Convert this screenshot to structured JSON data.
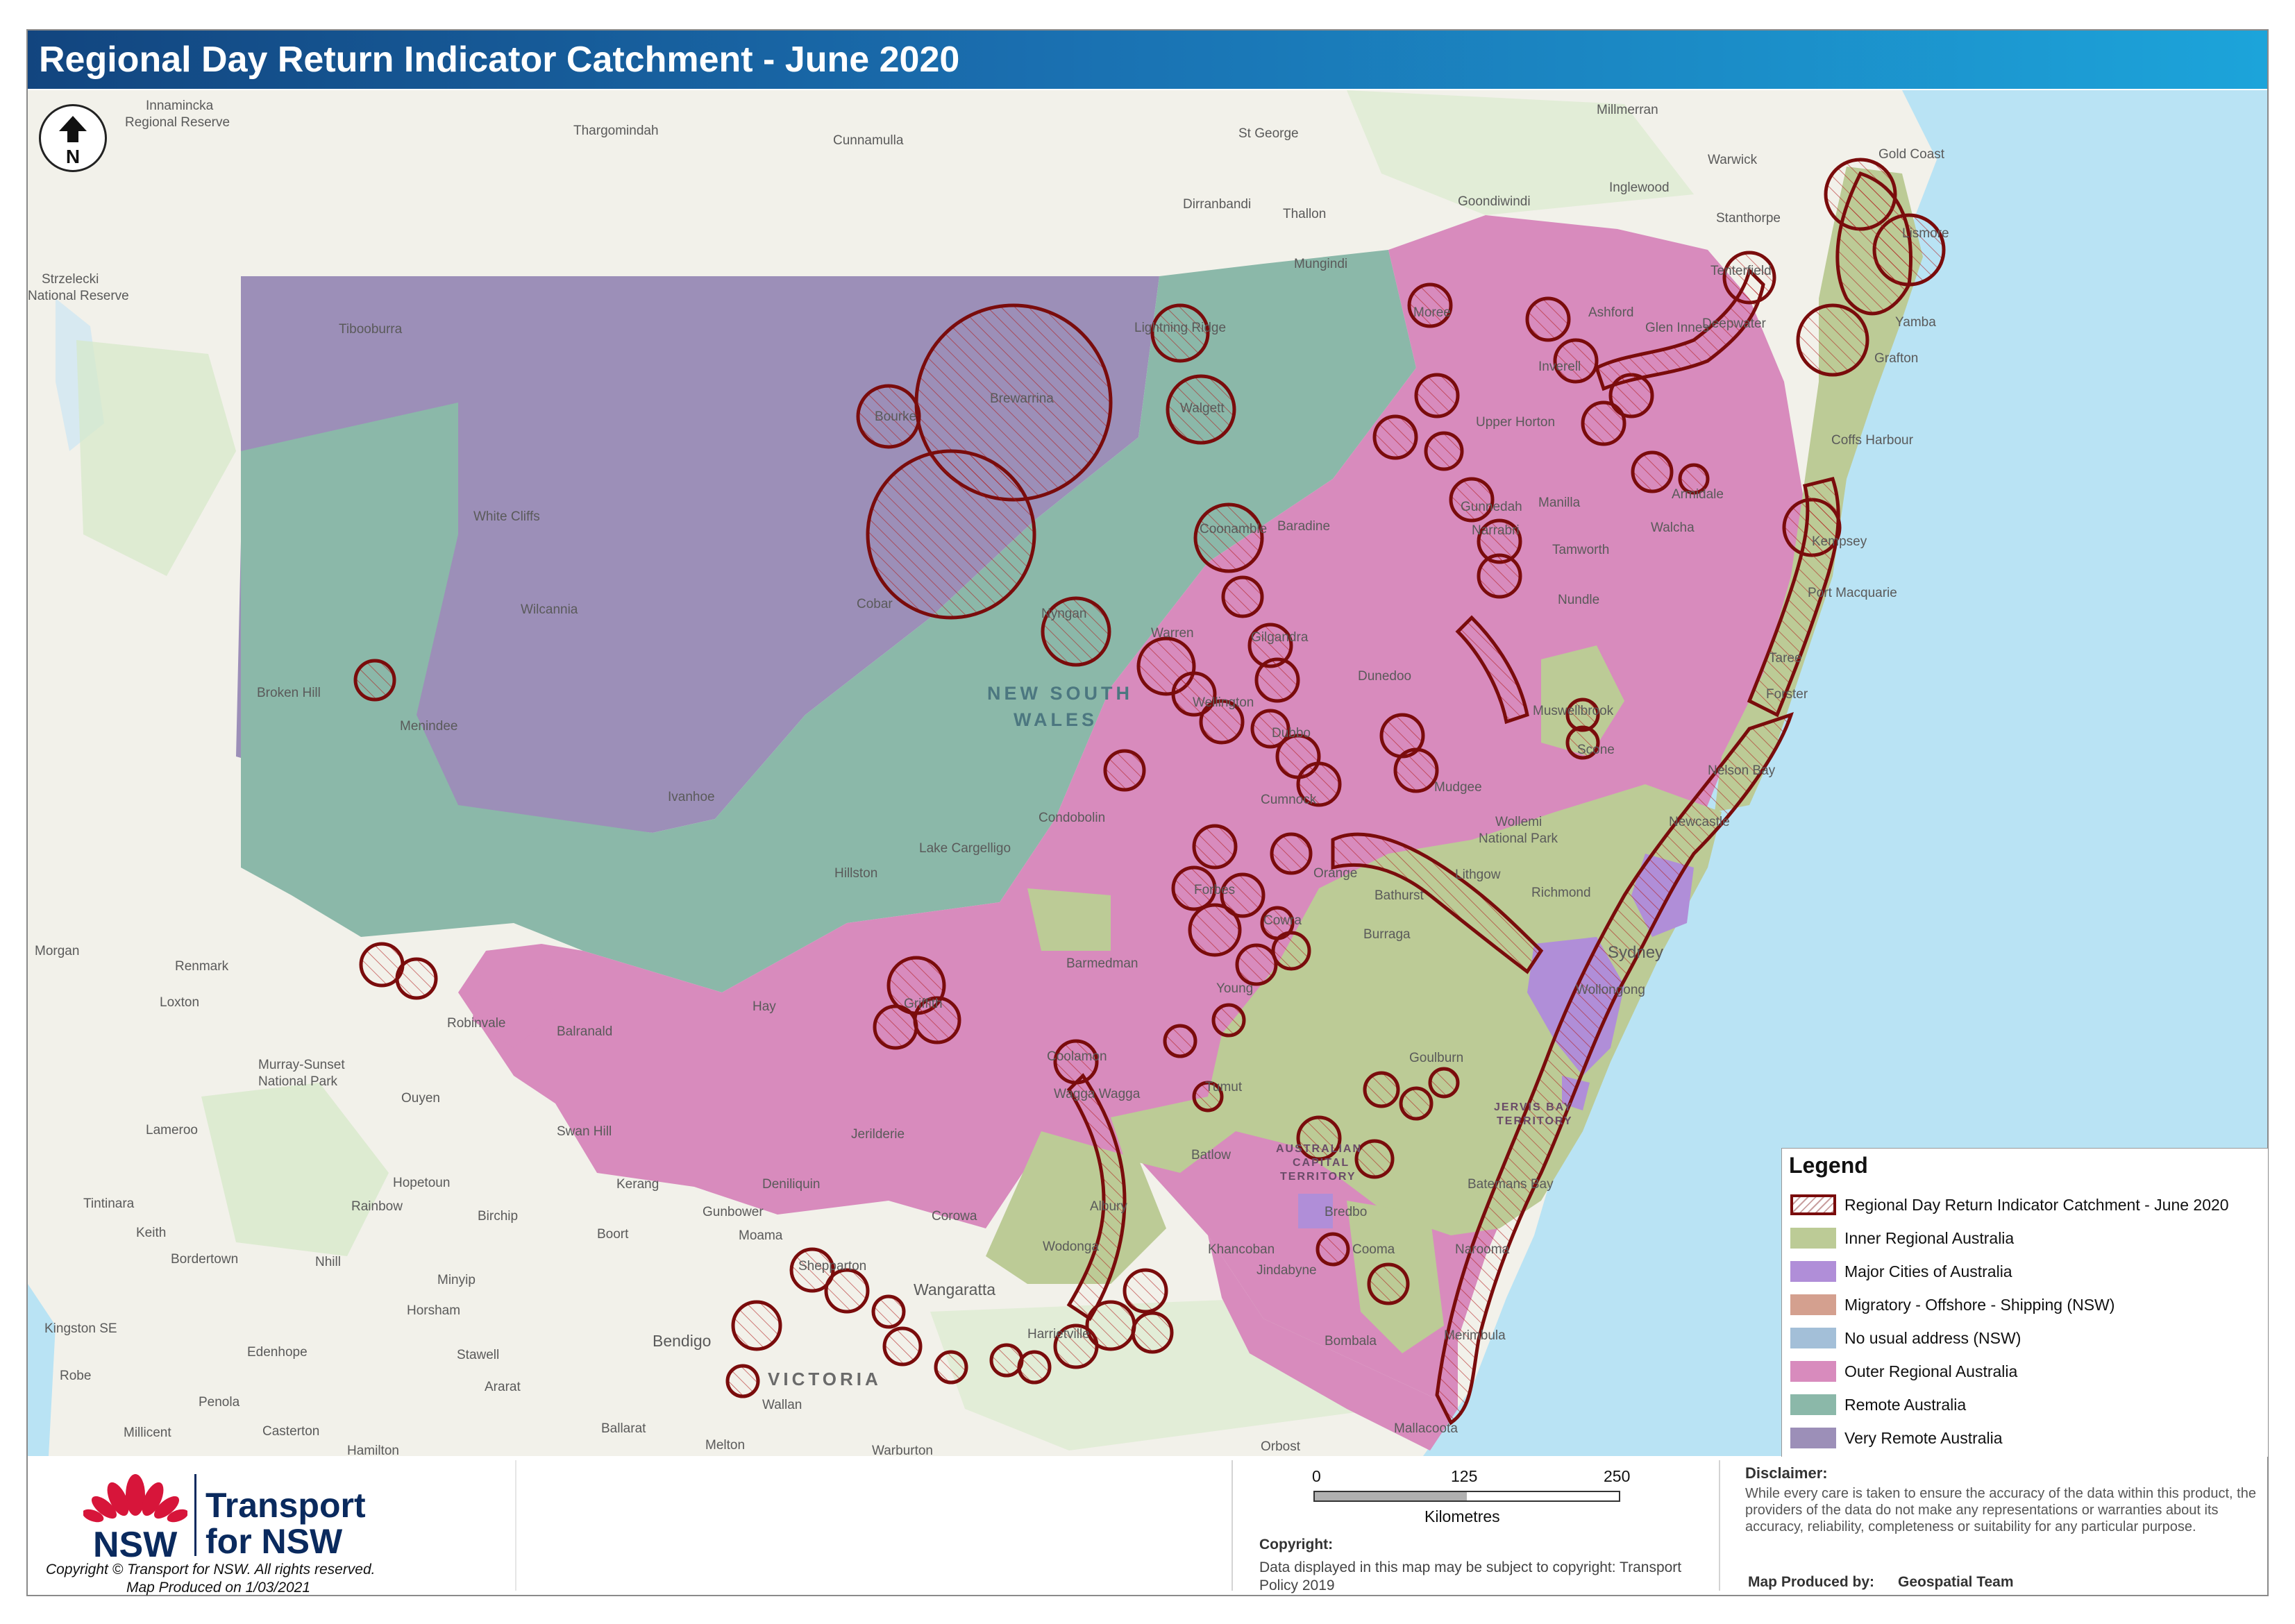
{
  "title": "Regional Day Return Indicator Catchment - June 2020",
  "north_label": "N",
  "colors": {
    "inner_regional": "#bccb96",
    "major_cities": "#b08ed8",
    "migratory": "#d4a08f",
    "no_usual_address": "#a3bfd8",
    "outer_regional": "#d88bbd",
    "remote": "#8bb8a9",
    "very_remote": "#9c8fb8",
    "catchment_outline": "#7a0c0c",
    "ocean": "#b9e3f4",
    "land": "#f2f1ea"
  },
  "legend": {
    "title": "Legend",
    "items": [
      {
        "label": "Regional Day Return Indicator Catchment - June 2020",
        "swatch": "catchment"
      },
      {
        "label": "Inner Regional Australia",
        "swatch": "#bccb96"
      },
      {
        "label": "Major Cities of Australia",
        "swatch": "#b08ed8"
      },
      {
        "label": "Migratory - Offshore - Shipping (NSW)",
        "swatch": "#d4a08f"
      },
      {
        "label": "No usual address (NSW)",
        "swatch": "#a3bfd8"
      },
      {
        "label": "Outer Regional Australia",
        "swatch": "#d88bbd"
      },
      {
        "label": "Remote Australia",
        "swatch": "#8bb8a9"
      },
      {
        "label": "Very Remote Australia",
        "swatch": "#9c8fb8"
      }
    ]
  },
  "places": {
    "innamincka": "Innamincka",
    "innamincka2": "Regional Reserve",
    "thargomindah": "Thargomindah",
    "cunnamulla": "Cunnamulla",
    "stgeorge": "St George",
    "millmerran": "Millmerran",
    "warwick": "Warwick",
    "goldcoast": "Gold Coast",
    "inglewood": "Inglewood",
    "dirranbandi": "Dirranbandi",
    "thallon": "Thallon",
    "goondiwindi": "Goondiwindi",
    "stanthorpe": "Stanthorpe",
    "mungindi": "Mungindi",
    "strzelecki": "Strzelecki",
    "strzelecki2": "National Reserve",
    "tibooburra": "Tibooburra",
    "lightningridge": "Lightning Ridge",
    "ashford": "Ashford",
    "brewarrina": "Brewarrina",
    "walgett": "Walgett",
    "bourke": "Bourke",
    "upperhorton": "Upper Horton",
    "coffsharbour": "Coffs Harbour",
    "whitecliffs": "White Cliffs",
    "armidale": "Armidale",
    "baradine": "Baradine",
    "coonamble": "Coonamble",
    "walcha": "Walcha",
    "kempsey": "Kempsey",
    "wilcannia": "Wilcannia",
    "cobar": "Cobar",
    "nundle": "Nundle",
    "portmacquarie": "Port Macquarie",
    "brokenhill": "Broken Hill",
    "newsouthwales1": "NEW SOUTH",
    "newsouthwales2": "WALES",
    "dunedoo": "Dunedoo",
    "menindee": "Menindee",
    "muswellbrook": "Muswellbrook",
    "ivanhoe": "Ivanhoe",
    "cumnock": "Cumnock",
    "condobolin": "Condobolin",
    "wollemi": "Wollemi",
    "wollemi2": "National Park",
    "newcastle": "Newcastle",
    "lakecargelligo": "Lake Cargelligo",
    "hillston": "Hillston",
    "sydney": "Sydney",
    "morgan": "Morgan",
    "renmark": "Renmark",
    "loxton": "Loxton",
    "barmedman": "Barmedman",
    "burraga": "Burraga",
    "hay": "Hay",
    "robinvale": "Robinvale",
    "balranald": "Balranald",
    "young": "Young",
    "murraysunset": "Murray-Sunset",
    "murraysunset2": "National Park",
    "ouyen": "Ouyen",
    "lameroo": "Lameroo",
    "swanhill": "Swan Hill",
    "jerilderie": "Jerilderie",
    "tumut": "Tumut",
    "actlabel1": "AUSTRALIAN",
    "actlabel2": "CAPITAL",
    "actlabel3": "TERRITORY",
    "batlow": "Batlow",
    "kerang": "Kerang",
    "hopetoun": "Hopetoun",
    "rainbow": "Rainbow",
    "birchip": "Birchip",
    "tintinara": "Tintinara",
    "keith": "Keith",
    "boort": "Boort",
    "bordertown": "Bordertown",
    "nhill": "Nhill",
    "minyip": "Minyip",
    "shepparton": "Shepparton",
    "khancoban": "Khancoban",
    "jindabyne": "Jindabyne",
    "cooma": "Cooma",
    "wangaratta": "Wangaratta",
    "horsham": "Horsham",
    "kingstonse": "Kingston SE",
    "bendigo": "Bendigo",
    "harrietville": "Harrietville",
    "bombala": "Bombala",
    "edenhope": "Edenhope",
    "stawell": "Stawell",
    "robe": "Robe",
    "victoria": "VICTORIA",
    "ararat": "Ararat",
    "penola": "Penola",
    "wallan": "Wallan",
    "millicent": "Millicent",
    "casterton": "Casterton",
    "ballarat": "Ballarat",
    "mallacoota": "Mallacoota",
    "hamilton": "Hamilton",
    "melton": "Melton",
    "warburton": "Warburton",
    "orbost": "Orbost",
    "gunbower": "Gunbower",
    "deniliquin": "Deniliquin",
    "griffith": "Griffith",
    "coolamon": "Coolamon",
    "waggawagga": "Wagga Wagga",
    "forbes": "Forbes",
    "orange": "Orange",
    "lithgow": "Lithgow",
    "richmond": "Richmond",
    "bathurst": "Bathurst",
    "cowra": "Cowra",
    "wollongong": "Wollongong",
    "goulburn": "Goulburn",
    "jervisbay1": "JERVIS BAY",
    "jervisbay2": "TERRITORY",
    "batemansbay": "Batemans Bay",
    "narooma": "Narooma",
    "merimbula": "Merimbula",
    "bredbo": "Bredbo",
    "corowa": "Corowa",
    "wodonga": "Wodonga",
    "albury": "Albury",
    "moama": "Moama",
    "gunnedah": "Gunnedah",
    "tamworth": "Tamworth",
    "manilla": "Manilla",
    "narrabri": "Narrabri",
    "gilgandra": "Gilgandra",
    "dubbo": "Dubbo",
    "wellington": "Wellington",
    "mudgee": "Mudgee",
    "scone": "Scone",
    "nelsonbay": "Nelson Bay",
    "taree": "Taree",
    "forster": "Forster",
    "grafton": "Grafton",
    "lismore": "Lismore",
    "yamba": "Yamba",
    "glenn": "Glen Innes",
    "inverell": "Inverell",
    "tenterfield": "Tenterfield",
    "deepwater": "Deepwater",
    "moree": "Moree",
    "nyngan": "Nyngan",
    "warren": "Warren"
  },
  "logo": {
    "nsw": "NSW",
    "line1": "Transport",
    "line2": "for NSW"
  },
  "footer": {
    "copyright_line": "Copyright © Transport for NSW. All rights reserved.",
    "produced_line": "Map Produced on 1/03/2021",
    "scale": {
      "tick0": "0",
      "tick1": "125",
      "tick2": "250",
      "units": "Kilometres"
    },
    "copyright_heading": "Copyright:",
    "copyright_body": "Data displayed in this map may be subject to copyright: Transport Policy 2019",
    "disclaimer_heading": "Disclaimer:",
    "disclaimer_body": "While every care is taken to ensure the accuracy of the data within this product, the providers of the data do not make any representations or warranties about its accuracy, reliability, completeness or suitability for any particular purpose.",
    "produced_by_label": "Map Produced by:",
    "produced_by_value": "Geospatial Team"
  }
}
